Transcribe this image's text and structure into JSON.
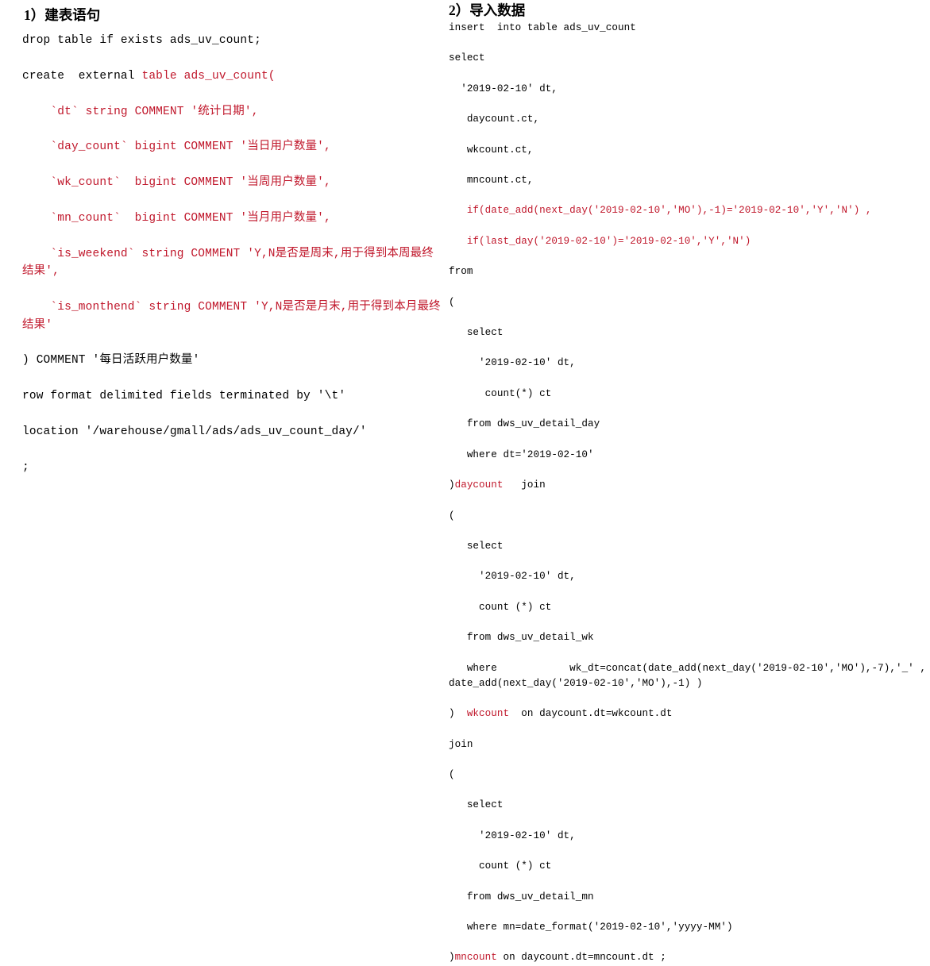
{
  "colors": {
    "text_black": "#000000",
    "text_red": "#c0172b",
    "background": "#ffffff"
  },
  "left_panel": {
    "heading": "1）建表语句",
    "code_lines": [
      {
        "color": "black",
        "text": "drop table if exists ads_uv_count;"
      },
      {
        "color": "mixed",
        "parts": [
          {
            "color": "black",
            "text": "create  external "
          },
          {
            "color": "red",
            "text": "table ads_uv_count("
          }
        ]
      },
      {
        "color": "red",
        "text": "    `dt` string COMMENT '统计日期',"
      },
      {
        "color": "red",
        "text": "    `day_count` bigint COMMENT '当日用户数量',"
      },
      {
        "color": "red",
        "text": "    `wk_count`  bigint COMMENT '当周用户数量',"
      },
      {
        "color": "red",
        "text": "    `mn_count`  bigint COMMENT '当月用户数量',"
      },
      {
        "color": "red",
        "text": "    `is_weekend` string COMMENT 'Y,N是否是周末,用于得到本周最终结果',"
      },
      {
        "color": "red",
        "text": "    `is_monthend` string COMMENT 'Y,N是否是月末,用于得到本月最终结果'"
      },
      {
        "color": "black",
        "text": ") COMMENT '每日活跃用户数量'"
      },
      {
        "color": "black",
        "text": "row format delimited fields terminated by '\\t'"
      },
      {
        "color": "black",
        "text": "location '/warehouse/gmall/ads/ads_uv_count_day/'"
      },
      {
        "color": "black",
        "text": ";"
      }
    ]
  },
  "right_panel": {
    "heading": "2）导入数据",
    "code_lines": [
      {
        "color": "black",
        "text": "insert  into table ads_uv_count"
      },
      {
        "color": "black",
        "text": "select"
      },
      {
        "color": "black",
        "text": "  '2019-02-10' dt,"
      },
      {
        "color": "black",
        "text": "   daycount.ct,"
      },
      {
        "color": "black",
        "text": "   wkcount.ct,"
      },
      {
        "color": "black",
        "text": "   mncount.ct,"
      },
      {
        "color": "red",
        "text": "   if(date_add(next_day('2019-02-10','MO'),-1)='2019-02-10','Y','N') ,"
      },
      {
        "color": "red",
        "text": "   if(last_day('2019-02-10')='2019-02-10','Y','N')"
      },
      {
        "color": "black",
        "text": "from"
      },
      {
        "color": "black",
        "text": "("
      },
      {
        "color": "black",
        "text": "   select"
      },
      {
        "color": "black",
        "text": "     '2019-02-10' dt,"
      },
      {
        "color": "black",
        "text": "      count(*) ct"
      },
      {
        "color": "black",
        "text": "   from dws_uv_detail_day"
      },
      {
        "color": "black",
        "text": "   where dt='2019-02-10'"
      },
      {
        "color": "mixed",
        "parts": [
          {
            "color": "black",
            "text": ")"
          },
          {
            "color": "red",
            "text": "daycount"
          },
          {
            "color": "black",
            "text": "   join"
          }
        ]
      },
      {
        "color": "black",
        "text": "("
      },
      {
        "color": "black",
        "text": "   select"
      },
      {
        "color": "black",
        "text": "     '2019-02-10' dt,"
      },
      {
        "color": "black",
        "text": "     count (*) ct"
      },
      {
        "color": "black",
        "text": "   from dws_uv_detail_wk"
      },
      {
        "color": "black",
        "text": "   where            wk_dt=concat(date_add(next_day('2019-02-10','MO'),-7),'_' ,date_add(next_day('2019-02-10','MO'),-1) )"
      },
      {
        "color": "mixed",
        "parts": [
          {
            "color": "black",
            "text": ")  "
          },
          {
            "color": "red",
            "text": "wkcount"
          },
          {
            "color": "black",
            "text": "  on daycount.dt=wkcount.dt"
          }
        ]
      },
      {
        "color": "black",
        "text": "join"
      },
      {
        "color": "black",
        "text": "("
      },
      {
        "color": "black",
        "text": "   select"
      },
      {
        "color": "black",
        "text": "     '2019-02-10' dt,"
      },
      {
        "color": "black",
        "text": "     count (*) ct"
      },
      {
        "color": "black",
        "text": "   from dws_uv_detail_mn"
      },
      {
        "color": "black",
        "text": "   where mn=date_format('2019-02-10','yyyy-MM')"
      },
      {
        "color": "mixed",
        "parts": [
          {
            "color": "black",
            "text": ")"
          },
          {
            "color": "red",
            "text": "mncount"
          },
          {
            "color": "black",
            "text": " on daycount.dt=mncount.dt ;"
          }
        ]
      }
    ]
  }
}
